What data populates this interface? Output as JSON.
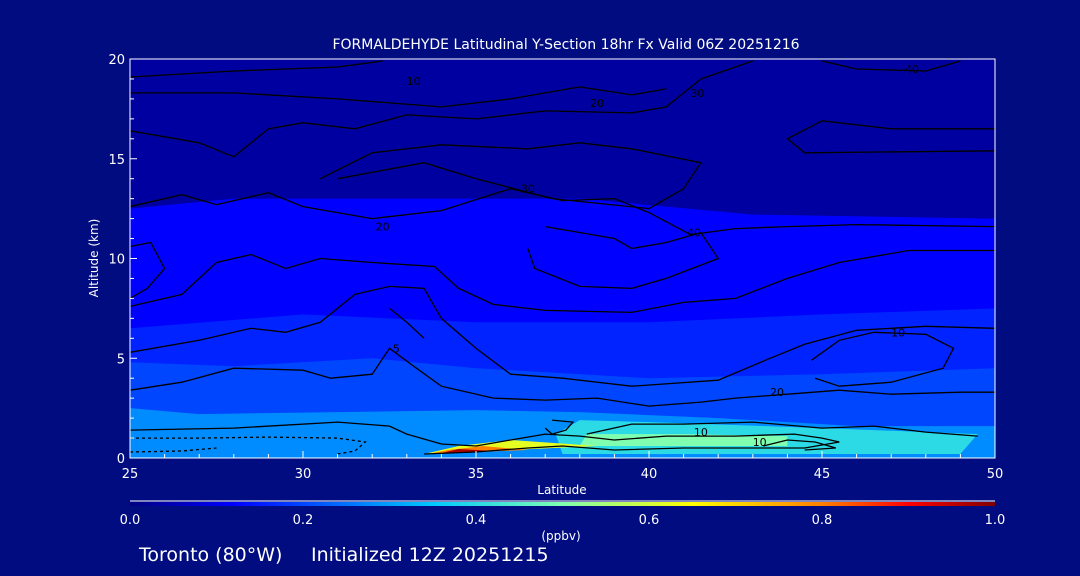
{
  "chart_data": {
    "type": "heatmap",
    "title": "FORMALDEHYDE Latitudinal Y-Section 18hr  Fx Valid 06Z 20251216",
    "xlabel": "Latitude",
    "ylabel": "Altitude (km)",
    "xlim": [
      25,
      50
    ],
    "ylim": [
      0,
      20
    ],
    "x_ticks": [
      "25",
      "30",
      "35",
      "40",
      "45",
      "50"
    ],
    "y_ticks": [
      "0",
      "5",
      "10",
      "15",
      "20"
    ],
    "colorbar": {
      "label": "(ppbv)",
      "range": [
        0.0,
        1.0
      ],
      "ticks": [
        "0.0",
        "0.2",
        "0.4",
        "0.6",
        "0.8",
        "1.0"
      ]
    },
    "fill_regions": [
      {
        "level": 0.03,
        "points": [
          [
            25,
            0
          ],
          [
            50,
            0
          ],
          [
            50,
            20
          ],
          [
            25,
            20
          ]
        ]
      },
      {
        "level": 0.12,
        "points": [
          [
            25,
            0
          ],
          [
            50,
            0
          ],
          [
            50,
            12
          ],
          [
            43,
            12.2
          ],
          [
            38,
            13
          ],
          [
            33,
            13
          ],
          [
            28,
            13
          ],
          [
            25,
            12.5
          ]
        ]
      },
      {
        "level": 0.16,
        "points": [
          [
            25,
            0
          ],
          [
            50,
            0
          ],
          [
            50,
            7.5
          ],
          [
            45,
            7.2
          ],
          [
            40,
            6.8
          ],
          [
            35,
            6.8
          ],
          [
            30,
            7.2
          ],
          [
            25,
            6.5
          ]
        ]
      },
      {
        "level": 0.2,
        "points": [
          [
            25,
            0
          ],
          [
            50,
            0
          ],
          [
            50,
            4.5
          ],
          [
            45,
            4.2
          ],
          [
            40,
            4
          ],
          [
            35,
            4.5
          ],
          [
            32,
            5
          ],
          [
            28,
            4.6
          ],
          [
            25,
            4.8
          ]
        ]
      },
      {
        "level": 0.28,
        "points": [
          [
            25,
            0
          ],
          [
            50,
            0
          ],
          [
            50,
            1.6
          ],
          [
            46,
            1.6
          ],
          [
            42,
            2
          ],
          [
            38,
            2.3
          ],
          [
            35,
            2.4
          ],
          [
            31,
            2.3
          ],
          [
            27,
            2.2
          ],
          [
            25,
            2.5
          ]
        ]
      },
      {
        "level": 0.4,
        "points": [
          [
            37.5,
            0.2
          ],
          [
            49,
            0.2
          ],
          [
            49.5,
            1.2
          ],
          [
            45,
            1.5
          ],
          [
            40,
            1.8
          ],
          [
            38,
            1.9
          ],
          [
            37.3,
            1.2
          ]
        ]
      },
      {
        "level": 0.5,
        "points": [
          [
            38,
            0.6
          ],
          [
            44,
            0.6
          ],
          [
            44,
            1.1
          ],
          [
            41,
            1.2
          ],
          [
            38.2,
            1.2
          ]
        ]
      },
      {
        "level": 0.62,
        "points": [
          [
            33.5,
            0.2
          ],
          [
            38.5,
            0.6
          ],
          [
            36,
            0.9
          ],
          [
            34.5,
            0.6
          ]
        ]
      },
      {
        "level": 0.8,
        "points": [
          [
            33.6,
            0.2
          ],
          [
            36.5,
            0.4
          ],
          [
            35.2,
            0.6
          ],
          [
            34.2,
            0.4
          ]
        ]
      },
      {
        "level": 0.97,
        "points": [
          [
            34,
            0.25
          ],
          [
            35.5,
            0.35
          ],
          [
            34.5,
            0.45
          ]
        ]
      }
    ],
    "contours": [
      {
        "level": "10",
        "points": [
          [
            25,
            19.1
          ],
          [
            28,
            19.4
          ],
          [
            31,
            19.6
          ],
          [
            32.3,
            19.9
          ]
        ]
      },
      {
        "level": "20",
        "points": [
          [
            25,
            18.3
          ],
          [
            28,
            18.3
          ],
          [
            31,
            18
          ],
          [
            34,
            17.6
          ],
          [
            36,
            18
          ],
          [
            38,
            18.6
          ],
          [
            39.5,
            18.2
          ],
          [
            40.5,
            18.5
          ]
        ]
      },
      {
        "level": "30",
        "points": [
          [
            25,
            16.4
          ],
          [
            27,
            15.8
          ],
          [
            28,
            15.1
          ],
          [
            29,
            16.5
          ],
          [
            30,
            16.8
          ],
          [
            31.5,
            16.5
          ],
          [
            33,
            17.2
          ],
          [
            35,
            17
          ],
          [
            37,
            17.4
          ],
          [
            39.5,
            17.3
          ],
          [
            40.5,
            17.6
          ],
          [
            41.5,
            19
          ],
          [
            43,
            19.9
          ]
        ]
      },
      {
        "level": "40",
        "points": [
          [
            45,
            19.9
          ],
          [
            46,
            19.5
          ],
          [
            48,
            19.4
          ],
          [
            49,
            19.9
          ]
        ]
      },
      {
        "level": "30",
        "points": [
          [
            50,
            16.5
          ],
          [
            47,
            16.5
          ],
          [
            45,
            16.9
          ],
          [
            44,
            16
          ],
          [
            44.5,
            15.3
          ],
          [
            50,
            15.4
          ]
        ]
      },
      {
        "level": "40",
        "points": [
          [
            30.5,
            14
          ],
          [
            32,
            15.3
          ],
          [
            34,
            15.7
          ],
          [
            36.5,
            15.5
          ],
          [
            38,
            15.8
          ],
          [
            39.5,
            15.5
          ],
          [
            41.5,
            14.8
          ],
          [
            41,
            13.5
          ],
          [
            40,
            12.5
          ],
          [
            37.2,
            13
          ],
          [
            35,
            14
          ],
          [
            33.5,
            14.8
          ],
          [
            31,
            14
          ]
        ]
      },
      {
        "level": "20",
        "points": [
          [
            25,
            12.6
          ],
          [
            26.5,
            13.2
          ],
          [
            27.5,
            12.7
          ],
          [
            29,
            13.3
          ],
          [
            30,
            12.6
          ],
          [
            32,
            12
          ],
          [
            34,
            12.4
          ],
          [
            36,
            13.5
          ],
          [
            37.5,
            12.9
          ],
          [
            39,
            13
          ],
          [
            40,
            12.3
          ],
          [
            41.2,
            11.2
          ],
          [
            42.5,
            11.5
          ],
          [
            44,
            11.6
          ],
          [
            46,
            11.7
          ],
          [
            50,
            11.6
          ]
        ]
      },
      {
        "level": "30",
        "points": [
          [
            37,
            11.6
          ],
          [
            39,
            11
          ],
          [
            39.5,
            10.5
          ],
          [
            40.5,
            10.8
          ],
          [
            41.5,
            11.3
          ],
          [
            42,
            10
          ],
          [
            40.5,
            9
          ],
          [
            39.5,
            8.5
          ],
          [
            38,
            8.6
          ],
          [
            36.7,
            9.5
          ],
          [
            36.5,
            10.5
          ]
        ]
      },
      {
        "level": "40",
        "points": [
          [
            25,
            10.6
          ],
          [
            25.6,
            10.8
          ],
          [
            26,
            9.5
          ],
          [
            25.5,
            8.5
          ],
          [
            25,
            8
          ]
        ]
      },
      {
        "level": "30",
        "points": [
          [
            25,
            7.6
          ],
          [
            26.5,
            8.2
          ],
          [
            27.5,
            9.8
          ],
          [
            28.5,
            10.2
          ],
          [
            29.5,
            9.5
          ],
          [
            30.5,
            10
          ],
          [
            32,
            9.8
          ],
          [
            33.8,
            9.6
          ],
          [
            34.5,
            8.5
          ],
          [
            35.5,
            7.7
          ],
          [
            37,
            7.4
          ],
          [
            39.5,
            7.3
          ],
          [
            41,
            7.8
          ],
          [
            42.5,
            8
          ],
          [
            44,
            9
          ],
          [
            45.5,
            9.8
          ],
          [
            47.5,
            10.4
          ],
          [
            50,
            10.4
          ]
        ]
      },
      {
        "level": "10",
        "points": [
          [
            25,
            5.3
          ],
          [
            27,
            5.9
          ],
          [
            28.5,
            6.5
          ],
          [
            29.5,
            6.3
          ],
          [
            30.5,
            6.8
          ],
          [
            31.5,
            8.2
          ],
          [
            32.5,
            8.6
          ],
          [
            33.5,
            8.5
          ],
          [
            34,
            7
          ],
          [
            35,
            5.5
          ],
          [
            36,
            4.2
          ],
          [
            37.5,
            4
          ],
          [
            39.5,
            3.6
          ],
          [
            42,
            3.9
          ],
          [
            43.5,
            5
          ],
          [
            44.5,
            5.7
          ],
          [
            46,
            6.4
          ],
          [
            48,
            6.6
          ],
          [
            50,
            6.5
          ]
        ]
      },
      {
        "level": "10",
        "points": [
          [
            44.7,
            4.9
          ],
          [
            45.5,
            5.9
          ],
          [
            46.5,
            6.3
          ],
          [
            48,
            6.2
          ],
          [
            48.8,
            5.5
          ],
          [
            48.5,
            4.5
          ],
          [
            47,
            3.8
          ],
          [
            45.5,
            3.6
          ],
          [
            44.8,
            4
          ]
        ]
      },
      {
        "level": "20",
        "points": [
          [
            25,
            3.4
          ],
          [
            26.5,
            3.8
          ],
          [
            28,
            4.5
          ],
          [
            30,
            4.4
          ],
          [
            30.8,
            4
          ],
          [
            32,
            4.2
          ],
          [
            32.5,
            5.5
          ],
          [
            33.2,
            4.6
          ],
          [
            34,
            3.6
          ],
          [
            35.5,
            3
          ],
          [
            37,
            2.9
          ],
          [
            38.5,
            3
          ],
          [
            40,
            2.6
          ],
          [
            41.5,
            2.8
          ],
          [
            42.5,
            3
          ],
          [
            44,
            3.2
          ],
          [
            45.5,
            3.4
          ],
          [
            47,
            3.2
          ],
          [
            49,
            3.3
          ],
          [
            50,
            3.3
          ]
        ]
      },
      {
        "level": "5",
        "points": [
          [
            32.5,
            7.5
          ],
          [
            33,
            6.8
          ],
          [
            33.5,
            6
          ]
        ]
      },
      {
        "level": "5",
        "points": [
          [
            25,
            1.4
          ],
          [
            28,
            1.5
          ],
          [
            31,
            1.8
          ],
          [
            32.5,
            1.6
          ],
          [
            33,
            1.2
          ],
          [
            34,
            0.7
          ],
          [
            35,
            0.6
          ],
          [
            36,
            0.9
          ],
          [
            37,
            1.2
          ],
          [
            38,
            1.1
          ],
          [
            39,
            0.9
          ],
          [
            40.5,
            1.1
          ],
          [
            42.5,
            1.1
          ],
          [
            44.2,
            1.2
          ],
          [
            45,
            1
          ],
          [
            45.5,
            0.8
          ],
          [
            44.5,
            0.5
          ],
          [
            43,
            0.5
          ],
          [
            41,
            0.5
          ],
          [
            39,
            0.4
          ],
          [
            37.5,
            0.6
          ],
          [
            36.5,
            0.5
          ],
          [
            35,
            0.3
          ],
          [
            33.5,
            0.2
          ]
        ]
      },
      {
        "level": "10",
        "points": [
          [
            38.2,
            1.2
          ],
          [
            39.5,
            1.7
          ],
          [
            41,
            1.7
          ],
          [
            43,
            1.8
          ],
          [
            45,
            1.5
          ],
          [
            46.5,
            1.6
          ],
          [
            48,
            1.3
          ],
          [
            49.5,
            1.1
          ]
        ]
      },
      {
        "level": "10",
        "points": [
          [
            43.3,
            0.6
          ],
          [
            44,
            0.9
          ],
          [
            44.8,
            0.8
          ],
          [
            45.4,
            0.5
          ],
          [
            44.5,
            0.4
          ]
        ]
      },
      {
        "level": "",
        "points": [
          [
            37.2,
            1.9
          ],
          [
            37.8,
            1.8
          ],
          [
            37.6,
            1.4
          ],
          [
            37.2,
            1.2
          ],
          [
            37,
            1.5
          ]
        ]
      }
    ],
    "dashed_contours": [
      {
        "points": [
          [
            25,
            1
          ],
          [
            27,
            1
          ],
          [
            29,
            1.05
          ],
          [
            31,
            1
          ],
          [
            31.8,
            0.8
          ],
          [
            31.5,
            0.35
          ],
          [
            31,
            0.2
          ]
        ]
      },
      {
        "points": [
          [
            25,
            0.3
          ],
          [
            26.5,
            0.35
          ],
          [
            27.5,
            0.5
          ]
        ]
      }
    ],
    "contour_labels": [
      {
        "text": "10",
        "x": 33.2,
        "y": 18.9
      },
      {
        "text": "20",
        "x": 38.5,
        "y": 17.8
      },
      {
        "text": "30",
        "x": 41.4,
        "y": 18.3
      },
      {
        "text": "40",
        "x": 47.6,
        "y": 19.5
      },
      {
        "text": "30",
        "x": 36.5,
        "y": 13.5
      },
      {
        "text": "20",
        "x": 32.3,
        "y": 11.6
      },
      {
        "text": "40",
        "x": 41.3,
        "y": 11.3
      },
      {
        "text": "10",
        "x": 47.2,
        "y": 6.3
      },
      {
        "text": "10",
        "x": 41.5,
        "y": 1.3
      },
      {
        "text": "10",
        "x": 43.2,
        "y": 0.8
      },
      {
        "text": "20",
        "x": 43.7,
        "y": 3.3
      },
      {
        "text": "5",
        "x": 32.7,
        "y": 5.5
      }
    ]
  },
  "footer": {
    "location": "Toronto (80°W)",
    "initialized": "Initialized 12Z 20251215"
  },
  "colors": {
    "background": "#000c80",
    "frame": "#ffffff",
    "contour": "#000000"
  }
}
